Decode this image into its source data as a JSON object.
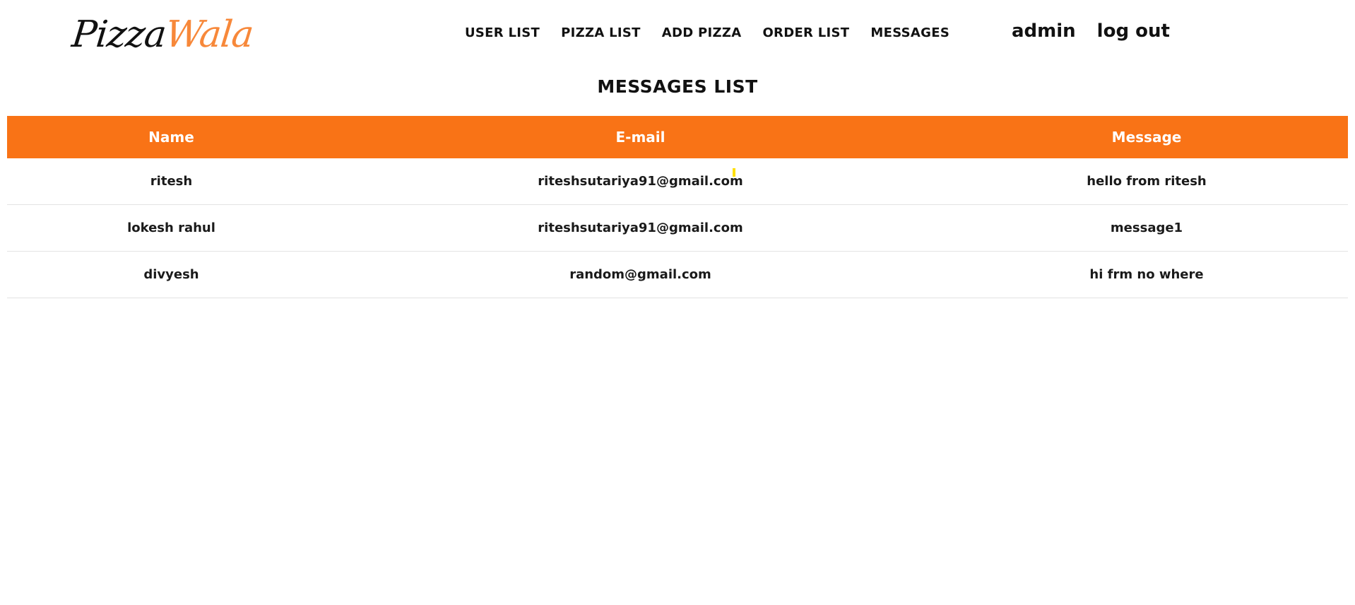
{
  "logo": {
    "part1": "Pizza",
    "part2": "Wala",
    "accent_color": "#f7883a"
  },
  "nav": {
    "items": [
      {
        "label": "USER LIST"
      },
      {
        "label": "PIZZA LIST"
      },
      {
        "label": "ADD PIZZA"
      },
      {
        "label": "ORDER LIST"
      },
      {
        "label": "MESSAGES"
      }
    ]
  },
  "user": {
    "name": "admin",
    "logout_label": "log out"
  },
  "page": {
    "title": "MESSAGES LIST"
  },
  "table": {
    "header_color": "#f97316",
    "columns": [
      "Name",
      "E-mail",
      "Message"
    ],
    "rows": [
      [
        "ritesh",
        "riteshsutariya91@gmail.com",
        "hello from ritesh"
      ],
      [
        "lokesh rahul",
        "riteshsutariya91@gmail.com",
        "message1"
      ],
      [
        "divyesh",
        "random@gmail.com",
        "hi frm no where"
      ]
    ]
  }
}
